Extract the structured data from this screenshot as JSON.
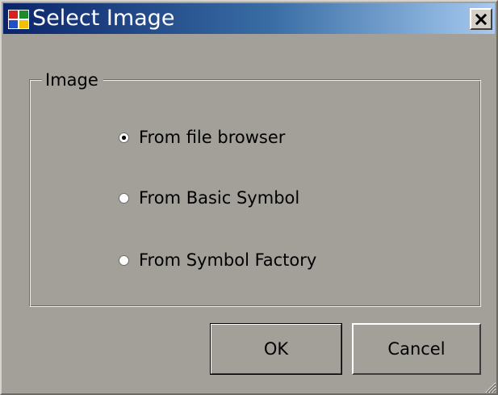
{
  "window": {
    "title": "Select Image",
    "close_label": "X"
  },
  "group": {
    "label": "Image"
  },
  "options": [
    {
      "label": "From file browser",
      "selected": true
    },
    {
      "label": "From Basic Symbol",
      "selected": false
    },
    {
      "label": "From Symbol Factory",
      "selected": false
    }
  ],
  "buttons": {
    "ok_label": "OK",
    "cancel_label": "Cancel"
  },
  "icons": {
    "app": "application-icon",
    "close": "close-icon",
    "grip": "resize-grip-icon"
  },
  "colors": {
    "titlebar_start": "#0a246a",
    "titlebar_end": "#a6caf0",
    "dialog_bg": "#a3a09a"
  }
}
